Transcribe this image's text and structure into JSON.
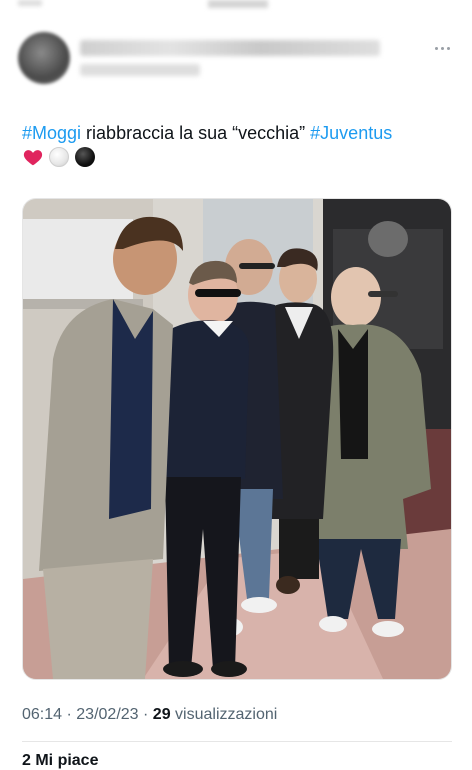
{
  "tweet": {
    "text_parts": [
      {
        "text": "#Moggi",
        "type": "hashtag"
      },
      {
        "text": " riabbraccia la sua “vecchia” ",
        "type": "text"
      },
      {
        "text": "#Juventus",
        "type": "hashtag"
      }
    ],
    "emojis": [
      "red-heart",
      "white-circle",
      "black-circle"
    ],
    "time": "06:14",
    "date": "23/02/23",
    "views_count": "29",
    "views_label": "visualizzazioni",
    "footer_partial": "2 Mi piace"
  },
  "colors": {
    "hashtag": "#1d9bf0",
    "text": "#0f1419",
    "meta": "#536471"
  }
}
